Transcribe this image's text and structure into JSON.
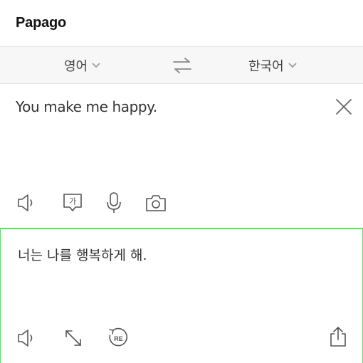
{
  "app": {
    "title": "Papago"
  },
  "languages": {
    "source": "영어",
    "target": "한국어"
  },
  "source": {
    "text": "You make me happy."
  },
  "result": {
    "text": "너는 나를 행복하게 해."
  },
  "icons": {
    "source_tools": [
      "speaker-icon",
      "korean-keyboard-icon",
      "microphone-icon",
      "camera-icon"
    ],
    "result_tools": [
      "speaker-icon",
      "expand-icon",
      "re-translate-icon",
      "share-icon"
    ],
    "korean_glyph": "가",
    "re_glyph": "RE"
  },
  "colors": {
    "accent_border": "#6fd27a",
    "lang_bar_bg": "#f7f7f7",
    "icon": "#555555"
  }
}
